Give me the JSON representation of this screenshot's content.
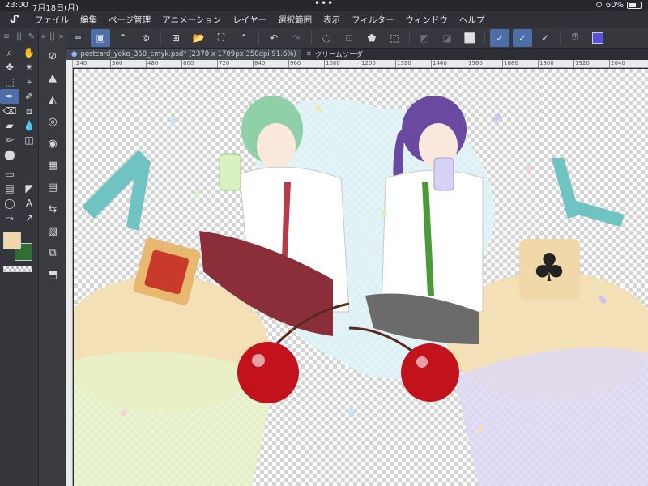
{
  "status": {
    "time": "23:00",
    "date": "7月18日(月)",
    "dots": "•••",
    "battery": "60%"
  },
  "app": {
    "logo": "ᔑ"
  },
  "menu": [
    "ファイル",
    "編集",
    "ページ管理",
    "アニメーション",
    "レイヤー",
    "選択範囲",
    "表示",
    "フィルター",
    "ウィンドウ",
    "ヘルプ"
  ],
  "tools": {
    "col1_head": [
      "≡",
      "||",
      "✎"
    ],
    "col1_head2": [
      "«",
      "||",
      "»"
    ],
    "grid": [
      "⌕",
      "✋",
      "✥",
      "✴",
      "⬚",
      "⌖",
      "✒",
      "✐",
      "⌫",
      "⧈",
      "▰",
      "💧",
      "✏",
      "◫",
      "⬤",
      ""
    ],
    "grid2": [
      "▭",
      "",
      "▤",
      "◤",
      "◯",
      "A",
      "⤳",
      "↗"
    ],
    "col2": [
      "⊘",
      "▲",
      "◭",
      "◎",
      "◉",
      "▦",
      "▤",
      "⇆",
      "▧",
      "⧉",
      "⬒"
    ],
    "colors": {
      "main": "#f0d6a8",
      "sub": "#2f6f31"
    }
  },
  "commands": {
    "left": [
      "≡",
      "▣",
      "⌃",
      "⊚",
      "⊞",
      "📂",
      "⛶",
      "⌃",
      "↶",
      "↷",
      "◌",
      "⊡",
      "⬟",
      "⬚",
      "◩",
      "◪",
      "⬜"
    ],
    "right": [
      "✓",
      "✓",
      "✓",
      "⍰"
    ],
    "color": "#5b4fe0"
  },
  "tabs": [
    {
      "label": "postcard_yoko_350_cmyk.psd* (2370 x 1709px 350dpi 91.6%)",
      "close": "✕"
    },
    {
      "label": "クリームソーダ",
      "close": "✕"
    }
  ],
  "ruler": [
    "240",
    "360",
    "480",
    "600",
    "720",
    "840",
    "960",
    "1080",
    "1200",
    "1320",
    "1440",
    "1560",
    "1680",
    "1800",
    "1920",
    "2040"
  ]
}
